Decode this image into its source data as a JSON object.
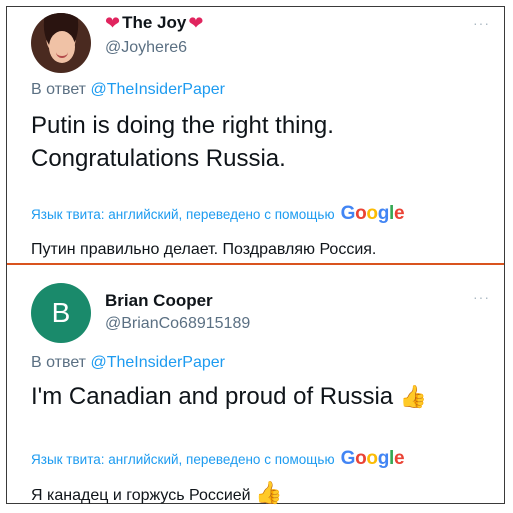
{
  "tweets": [
    {
      "name": "The Joy",
      "handle": "@Joyhere6",
      "more": "···",
      "reply_prefix": "В ответ",
      "reply_mention": "@TheInsiderPaper",
      "body_line1": "Putin is doing the right thing.",
      "body_line2": "Congratulations Russia.",
      "translated_label": "Язык твита: английский, переведено с помощью",
      "translation": "Путин правильно делает. Поздравляю Россия."
    },
    {
      "name": "Brian Cooper",
      "avatar_letter": "B",
      "avatar_color": "#1a8a6b",
      "handle": "@BrianCo68915189",
      "more": "···",
      "reply_prefix": "В ответ",
      "reply_mention": "@TheInsiderPaper",
      "body": "I'm Canadian and proud of Russia",
      "translated_label": "Язык твита: английский, переведено с помощью",
      "translation": "Я канадец и горжусь Россией"
    }
  ],
  "google": {
    "g1": "G",
    "o1": "o",
    "o2": "o",
    "g2": "g",
    "l": "l",
    "e": "e"
  },
  "colors": {
    "link": "#1d9bf0",
    "muted": "#5b7083",
    "divider": "#d9531e",
    "heart": "#e0245e"
  },
  "icons": {
    "heart": "❤",
    "thumbs_up": "👍"
  }
}
